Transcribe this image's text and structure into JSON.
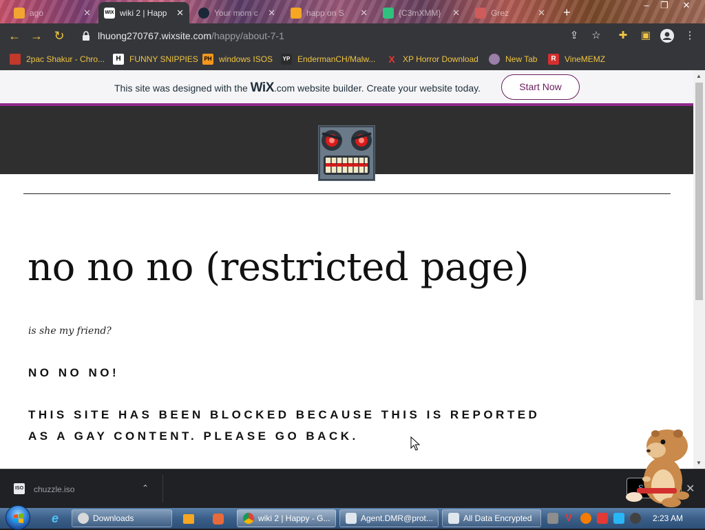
{
  "browser": {
    "tabs": [
      {
        "title": "ago",
        "active": false
      },
      {
        "title": "wiki 2 | Happ",
        "active": true
      },
      {
        "title": "Your mom c",
        "active": false
      },
      {
        "title": "happ on S",
        "active": false
      },
      {
        "title": "{C3mXMM}",
        "active": false
      },
      {
        "title": "Grez",
        "active": false
      }
    ],
    "close_glyph": "✕",
    "new_tab_glyph": "+",
    "address": {
      "domain": "lhuong270767.wixsite.com",
      "path": "/happy/about-7-1"
    },
    "bookmarks": [
      {
        "label": "2pac Shakur - Chro...",
        "icon": "fire-icon"
      },
      {
        "label": "FUNNY SNIPPIES",
        "icon": "h-icon"
      },
      {
        "label": "windows ISOS",
        "icon": "ph-icon"
      },
      {
        "label": "EndermanCH/Malw...",
        "icon": "yp-icon"
      },
      {
        "label": "XP Horror Download",
        "icon": "x-icon"
      },
      {
        "label": "New Tab",
        "icon": "globe-icon"
      },
      {
        "label": "VineMEMZ",
        "icon": "r-icon"
      }
    ]
  },
  "wix_banner": {
    "text_before": "This site was designed with the ",
    "brand": "WiX",
    "brand_suffix": ".com",
    "text_after": " website builder. Create your website today.",
    "cta": "Start Now"
  },
  "page": {
    "title": "no no no (restricted page)",
    "subtitle": "is she my friend?",
    "line1": "NO NO NO!",
    "line2": "THIS SITE HAS BEEN BLOCKED BECAUSE THIS IS REPORTED",
    "line3": "AS A GAY CONTENT. PLEASE GO BACK."
  },
  "download_shelf": {
    "file_name": "chuzzle.iso",
    "file_icon_text": "ISO",
    "show_all_label": "S"
  },
  "taskbar": {
    "tasks": [
      {
        "label": "Downloads",
        "icon": "downloads-icon"
      },
      {
        "label": "wiki 2 | Happy - G...",
        "icon": "chrome-icon"
      },
      {
        "label": "Agent.DMR@prot...",
        "icon": "window-icon"
      },
      {
        "label": "All Data Encrypted",
        "icon": "window-icon"
      }
    ],
    "clock": "2:23 AM"
  },
  "colors": {
    "wix_purple": "#8e2a8a",
    "cta_border": "#6a1b5d",
    "header_dark": "#2f2f2f",
    "bookmark_text": "#f0c542"
  }
}
